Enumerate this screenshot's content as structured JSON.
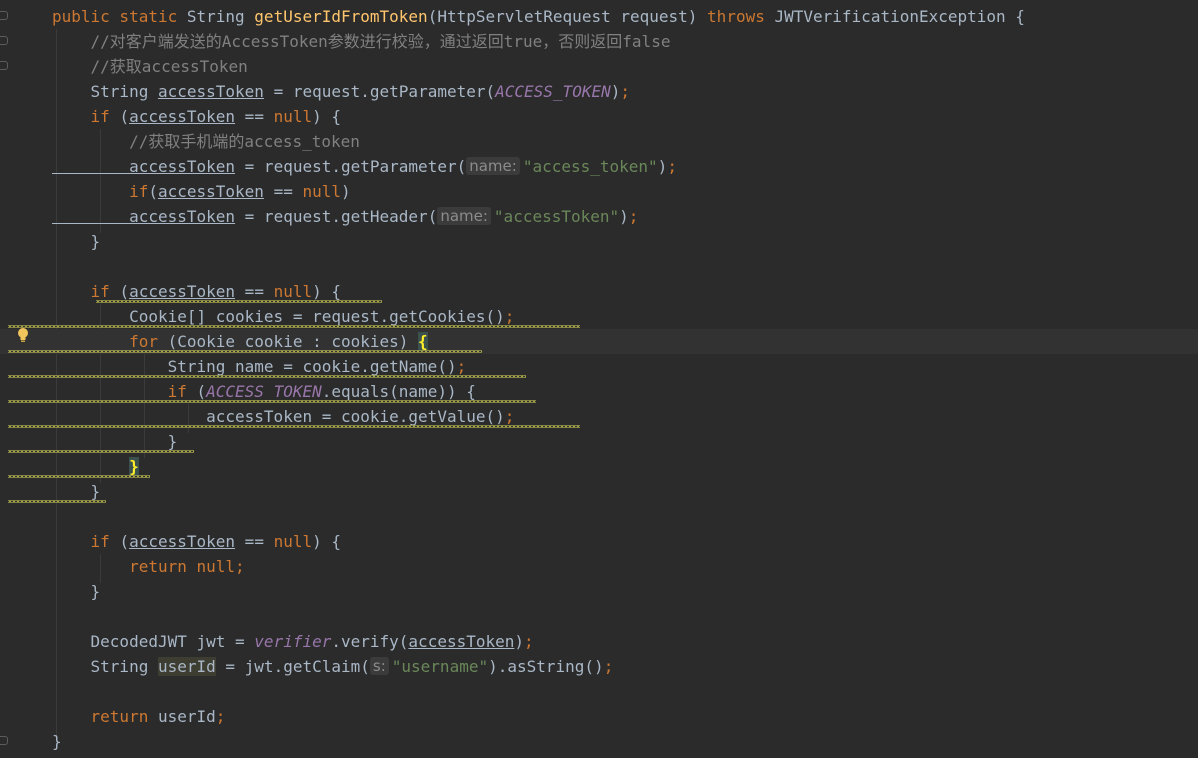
{
  "editor": {
    "colors": {
      "background": "#2b2b2b",
      "keyword": "#cc7832",
      "function": "#ffc66d",
      "comment": "#808080",
      "string": "#6a8759",
      "static_field": "#9876aa",
      "plain": "#a9b7c6"
    },
    "icons": [
      "fold-icon",
      "lightbulb-icon"
    ],
    "lines": [
      [
        {
          "t": "kw",
          "v": "public static "
        },
        {
          "t": "pl",
          "v": "String "
        },
        {
          "t": "fn",
          "v": "getUserIdFromToken"
        },
        {
          "t": "pl",
          "v": "(HttpServletRequest request) "
        },
        {
          "t": "kw",
          "v": "throws "
        },
        {
          "t": "pl",
          "v": "JWTVerificationException {"
        }
      ],
      [
        {
          "t": "cm",
          "v": "    //对客户端发送的AccessToken参数进行校验，通过返回true，否则返回false"
        }
      ],
      [
        {
          "t": "cm",
          "v": "    //获取accessToken"
        }
      ],
      [
        {
          "t": "pl",
          "v": "    String "
        },
        {
          "t": "ul",
          "v": "accessToken"
        },
        {
          "t": "pl",
          "v": " = request.getParameter("
        },
        {
          "t": "sf",
          "v": "ACCESS_TOKEN"
        },
        {
          "t": "pl",
          "v": ")"
        },
        {
          "t": "kw",
          "v": ";"
        }
      ],
      [
        {
          "t": "kw",
          "v": "    if "
        },
        {
          "t": "pl",
          "v": "("
        },
        {
          "t": "ul",
          "v": "accessToken"
        },
        {
          "t": "pl",
          "v": " == "
        },
        {
          "t": "kw",
          "v": "null"
        },
        {
          "t": "pl",
          "v": ") {"
        }
      ],
      [
        {
          "t": "cm",
          "v": "        //获取手机端的access_token"
        }
      ],
      [
        {
          "t": "ul",
          "v": "        accessToken"
        },
        {
          "t": "pl",
          "v": " = request.getParameter("
        },
        {
          "t": "hint",
          "v": "name:"
        },
        {
          "t": "st",
          "v": "\"access_token\""
        },
        {
          "t": "pl",
          "v": ")"
        },
        {
          "t": "kw",
          "v": ";"
        }
      ],
      [
        {
          "t": "kw",
          "v": "        if"
        },
        {
          "t": "pl",
          "v": "("
        },
        {
          "t": "ul",
          "v": "accessToken"
        },
        {
          "t": "pl",
          "v": " == "
        },
        {
          "t": "kw",
          "v": "null"
        },
        {
          "t": "pl",
          "v": ")"
        }
      ],
      [
        {
          "t": "ul",
          "v": "        accessToken"
        },
        {
          "t": "pl",
          "v": " = request.getHeader("
        },
        {
          "t": "hint",
          "v": "name:"
        },
        {
          "t": "st",
          "v": "\"accessToken\""
        },
        {
          "t": "pl",
          "v": ")"
        },
        {
          "t": "kw",
          "v": ";"
        }
      ],
      [
        {
          "t": "pl",
          "v": "    }"
        }
      ],
      [],
      [
        {
          "t": "kw",
          "v": "    if "
        },
        {
          "t": "pl",
          "v": "("
        },
        {
          "t": "ul",
          "v": "accessToken"
        },
        {
          "t": "pl",
          "v": " == "
        },
        {
          "t": "kw",
          "v": "null"
        },
        {
          "t": "pl",
          "v": ") {"
        }
      ],
      [
        {
          "t": "pl",
          "v": "        Cookie[] cookies = request.getCookies()"
        },
        {
          "t": "kw",
          "v": ";"
        }
      ],
      [
        {
          "t": "kw",
          "v": "        for "
        },
        {
          "t": "pl",
          "v": "(Cookie cookie : cookies) "
        },
        {
          "t": "brace",
          "v": "{"
        }
      ],
      [
        {
          "t": "pl",
          "v": "            String name = cookie.getName()"
        },
        {
          "t": "kw",
          "v": ";"
        }
      ],
      [
        {
          "t": "kw",
          "v": "            if "
        },
        {
          "t": "pl",
          "v": "("
        },
        {
          "t": "sf",
          "v": "ACCESS_TOKEN"
        },
        {
          "t": "pl",
          "v": ".equals(name)) {"
        }
      ],
      [
        {
          "t": "pl",
          "v": "                accessToken = cookie.getValue()"
        },
        {
          "t": "kw",
          "v": ";"
        }
      ],
      [
        {
          "t": "pl",
          "v": "            }"
        }
      ],
      [
        {
          "t": "pl",
          "v": "        "
        },
        {
          "t": "brace",
          "v": "}"
        }
      ],
      [
        {
          "t": "pl",
          "v": "    }"
        }
      ],
      [],
      [
        {
          "t": "kw",
          "v": "    if "
        },
        {
          "t": "pl",
          "v": "("
        },
        {
          "t": "ul",
          "v": "accessToken"
        },
        {
          "t": "pl",
          "v": " == "
        },
        {
          "t": "kw",
          "v": "null"
        },
        {
          "t": "pl",
          "v": ") {"
        }
      ],
      [
        {
          "t": "kw",
          "v": "        return null;"
        }
      ],
      [
        {
          "t": "pl",
          "v": "    }"
        }
      ],
      [],
      [
        {
          "t": "pl",
          "v": "    DecodedJWT jwt = "
        },
        {
          "t": "sf",
          "v": "verifier"
        },
        {
          "t": "pl",
          "v": ".verify("
        },
        {
          "t": "ul",
          "v": "accessToken"
        },
        {
          "t": "pl",
          "v": ")"
        },
        {
          "t": "kw",
          "v": ";"
        }
      ],
      [
        {
          "t": "pl",
          "v": "    String "
        },
        {
          "t": "hlv",
          "v": "userId"
        },
        {
          "t": "pl",
          "v": " = jwt.getClaim("
        },
        {
          "t": "hint",
          "v": "s:"
        },
        {
          "t": "st",
          "v": "\"username\""
        },
        {
          "t": "pl",
          "v": ").asString()"
        },
        {
          "t": "kw",
          "v": ";"
        }
      ],
      [],
      [
        {
          "t": "kw",
          "v": "    return "
        },
        {
          "t": "pl",
          "v": "userId"
        },
        {
          "t": "kw",
          "v": ";"
        }
      ],
      [
        {
          "t": "pl",
          "v": "}"
        }
      ]
    ]
  }
}
